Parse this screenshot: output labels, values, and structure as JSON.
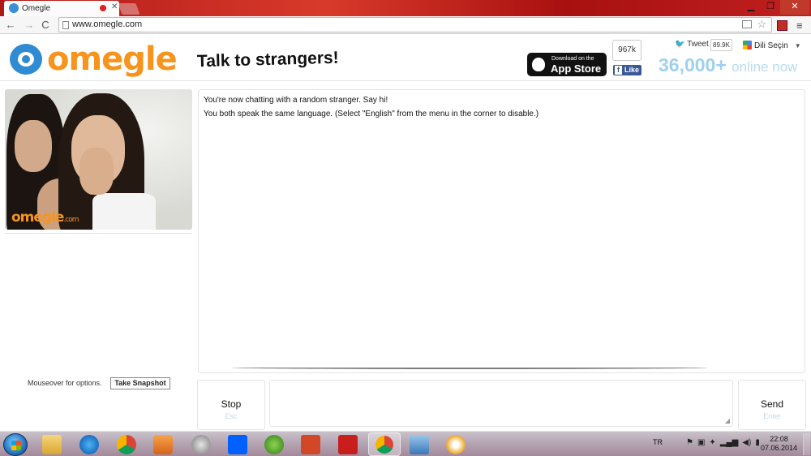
{
  "browser": {
    "tab_title": "Omegle",
    "url": "www.omegle.com",
    "back_glyph": "←",
    "forward_glyph": "→",
    "reload_glyph": "C",
    "star_glyph": "☆",
    "menu_glyph": "≡",
    "tab_close_glyph": "✕",
    "window_buttons": [
      "▁",
      "❐",
      "✕"
    ]
  },
  "header": {
    "logo_text": "omegle",
    "tagline": "Talk to strangers!",
    "app_store": {
      "line1": "Download on the",
      "line2": "App Store"
    },
    "fb_count": "967k",
    "fb_like_label": "Like",
    "fb_f": "f",
    "tweet_label": "Tweet",
    "tweet_bird": "🐦",
    "tweet_count": "89.9K",
    "language_label": "Dili Seçin",
    "language_arrow": "▼",
    "online_count": "36,000+",
    "online_label": "online now"
  },
  "video": {
    "watermark": "omegle",
    "watermark_suffix": ".com"
  },
  "chat": {
    "messages": [
      "You're now chatting with a random stranger. Say hi!",
      "You both speak the same language. (Select \"English\" from the menu in the corner to disable.)"
    ]
  },
  "controls": {
    "mouseover_text": "Mouseover for options.",
    "snapshot_label": "Take Snapshot",
    "stop_label": "Stop",
    "stop_key": "Esc",
    "send_label": "Send",
    "send_key": "Enter",
    "message_value": ""
  },
  "taskbar": {
    "language": "TR",
    "time": "22:08",
    "date": "07.06.2014",
    "tray_icons": [
      "flag-icon",
      "network-icon",
      "dropbox-tray-icon",
      "signal-icon",
      "volume-icon",
      "battery-icon"
    ],
    "tray_glyphs": [
      "⚑",
      "▣",
      "✦",
      "▂▄▆",
      "◀)",
      "▮"
    ]
  },
  "colors": {
    "brand_orange": "#f7941d",
    "brand_blue": "#2f8bd4",
    "online_blue": "#9fd0ef",
    "facebook_blue": "#3b5998"
  }
}
